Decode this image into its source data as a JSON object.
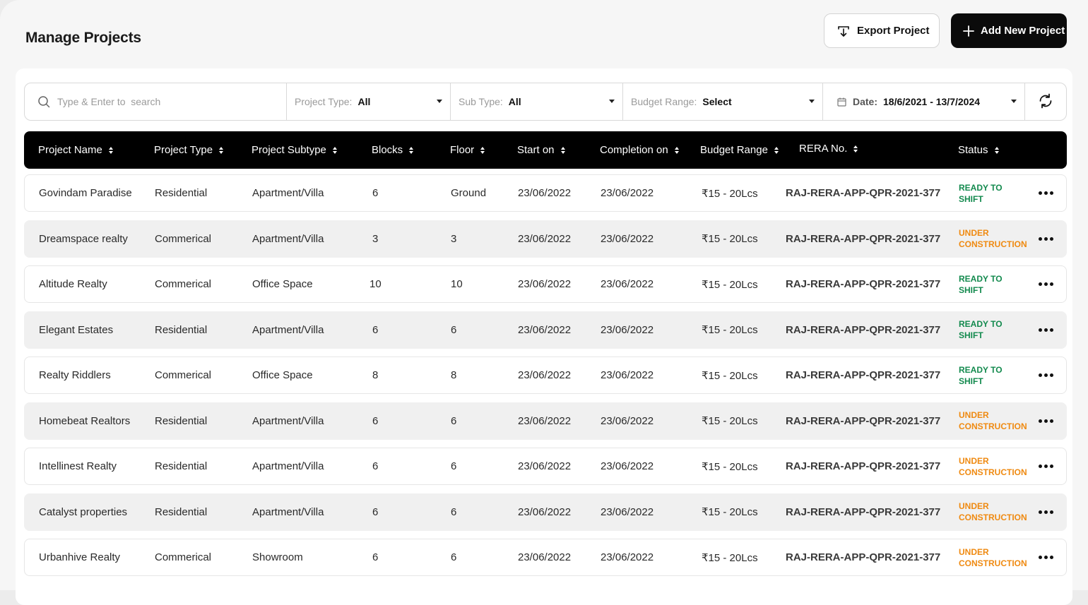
{
  "page": {
    "title": "Manage Projects"
  },
  "actions": {
    "export_label": "Export Project",
    "add_label": "Add New Project"
  },
  "filters": {
    "search_placeholder": "Type & Enter to  search",
    "project_type_label": "Project Type:",
    "project_type_value": "All",
    "sub_type_label": "Sub Type:",
    "sub_type_value": "All",
    "budget_label": "Budget Range:",
    "budget_value": "Select",
    "date_label": "Date:",
    "date_value": "18/6/2021 - 13/7/2024"
  },
  "columns": [
    "Project Name",
    "Project Type",
    "Project Subtype",
    "Blocks",
    "Floor",
    "Start on",
    "Completion on",
    "Budget Range",
    "RERA No.",
    "Status"
  ],
  "rows": [
    {
      "name": "Govindam Paradise",
      "type": "Residential",
      "subtype": "Apartment/Villa",
      "blocks": "6",
      "floor": "Ground",
      "start": "23/06/2022",
      "completion": "23/06/2022",
      "budget": "₹15 - 20Lcs",
      "rera": "RAJ-RERA-APP-QPR-2021-377",
      "status": "READY TO SHIFT",
      "status_kind": "ready"
    },
    {
      "name": "Dreamspace realty",
      "type": "Commerical",
      "subtype": "Apartment/Villa",
      "blocks": "3",
      "floor": "3",
      "start": "23/06/2022",
      "completion": "23/06/2022",
      "budget": "₹15 - 20Lcs",
      "rera": "RAJ-RERA-APP-QPR-2021-377",
      "status": "UNDER CONSTRUCTION",
      "status_kind": "under"
    },
    {
      "name": "Altitude Realty",
      "type": "Commerical",
      "subtype": "Office Space",
      "blocks": "10",
      "floor": "10",
      "start": "23/06/2022",
      "completion": "23/06/2022",
      "budget": "₹15 - 20Lcs",
      "rera": "RAJ-RERA-APP-QPR-2021-377",
      "status": "READY TO SHIFT",
      "status_kind": "ready"
    },
    {
      "name": "Elegant Estates",
      "type": "Residential",
      "subtype": "Apartment/Villa",
      "blocks": "6",
      "floor": "6",
      "start": "23/06/2022",
      "completion": "23/06/2022",
      "budget": "₹15 - 20Lcs",
      "rera": "RAJ-RERA-APP-QPR-2021-377",
      "status": "READY TO SHIFT",
      "status_kind": "ready"
    },
    {
      "name": "Realty Riddlers",
      "type": "Commerical",
      "subtype": "Office Space",
      "blocks": "8",
      "floor": "8",
      "start": "23/06/2022",
      "completion": "23/06/2022",
      "budget": "₹15 - 20Lcs",
      "rera": "RAJ-RERA-APP-QPR-2021-377",
      "status": "READY TO SHIFT",
      "status_kind": "ready"
    },
    {
      "name": "Homebeat Realtors",
      "type": "Residential",
      "subtype": "Apartment/Villa",
      "blocks": "6",
      "floor": "6",
      "start": "23/06/2022",
      "completion": "23/06/2022",
      "budget": "₹15 - 20Lcs",
      "rera": "RAJ-RERA-APP-QPR-2021-377",
      "status": "UNDER CONSTRUCTION",
      "status_kind": "under"
    },
    {
      "name": "Intellinest Realty",
      "type": "Residential",
      "subtype": "Apartment/Villa",
      "blocks": "6",
      "floor": "6",
      "start": "23/06/2022",
      "completion": "23/06/2022",
      "budget": "₹15 - 20Lcs",
      "rera": "RAJ-RERA-APP-QPR-2021-377",
      "status": "UNDER CONSTRUCTION",
      "status_kind": "under"
    },
    {
      "name": "Catalyst properties",
      "type": "Residential",
      "subtype": "Apartment/Villa",
      "blocks": "6",
      "floor": "6",
      "start": "23/06/2022",
      "completion": "23/06/2022",
      "budget": "₹15 - 20Lcs",
      "rera": "RAJ-RERA-APP-QPR-2021-377",
      "status": "UNDER CONSTRUCTION",
      "status_kind": "under"
    },
    {
      "name": "Urbanhive Realty",
      "type": "Commerical",
      "subtype": "Showroom",
      "blocks": "6",
      "floor": "6",
      "start": "23/06/2022",
      "completion": "23/06/2022",
      "budget": "₹15 - 20Lcs",
      "rera": "RAJ-RERA-APP-QPR-2021-377",
      "status": "UNDER CONSTRUCTION",
      "status_kind": "under"
    }
  ],
  "colors": {
    "ready": "#138a4e",
    "under": "#ef8a11",
    "header_bg": "#000000"
  },
  "icons": {
    "export": "download-tray-icon",
    "add": "plus-icon",
    "search": "search-icon",
    "date": "calendar-icon",
    "refresh": "refresh-icon",
    "row_menu": "more-horizontal-icon"
  }
}
